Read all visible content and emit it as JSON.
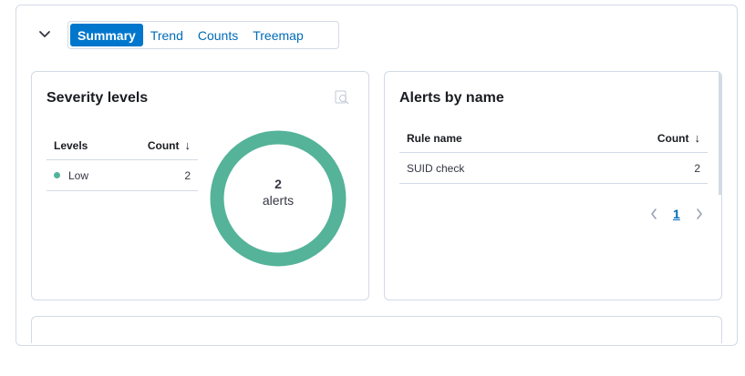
{
  "tabs": {
    "items": [
      {
        "label": "Summary",
        "active": true
      },
      {
        "label": "Trend",
        "active": false
      },
      {
        "label": "Counts",
        "active": false
      },
      {
        "label": "Treemap",
        "active": false
      }
    ]
  },
  "severity": {
    "title": "Severity levels",
    "col_levels": "Levels",
    "col_count": "Count",
    "sort_icon": "↓",
    "rows": [
      {
        "level": "Low",
        "count": "2",
        "color": "#54b399"
      }
    ],
    "donut": {
      "count": "2",
      "label": "alerts",
      "color": "#54b399"
    }
  },
  "alerts_by_name": {
    "title": "Alerts by name",
    "col_rule": "Rule name",
    "col_count": "Count",
    "sort_icon": "↓",
    "rows": [
      {
        "rule": "SUID check",
        "count": "2"
      }
    ],
    "pagination": {
      "current_page": "1"
    }
  },
  "colors": {
    "accent": "#0077cc",
    "link": "#006bb8",
    "border": "#d3dae6",
    "low_severity": "#54b399"
  }
}
